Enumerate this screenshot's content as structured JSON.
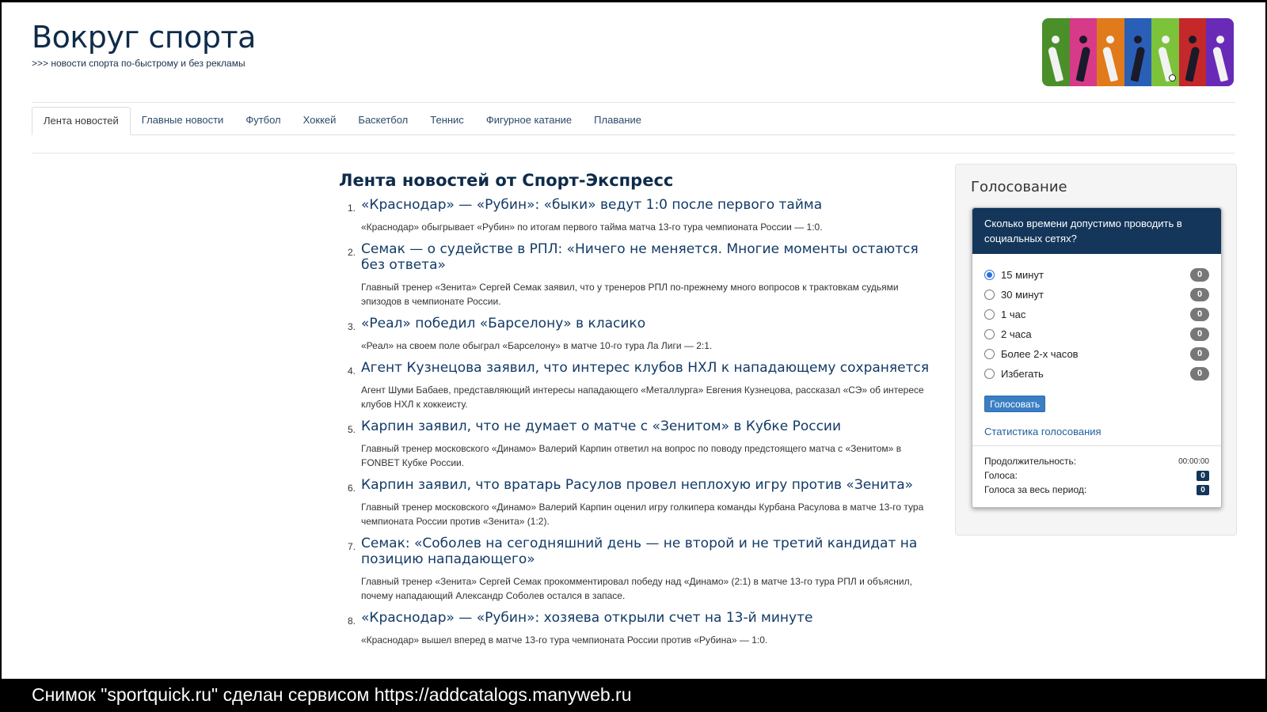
{
  "header": {
    "site_title": "Вокруг спорта",
    "tagline": ">>> новости спорта по-быстрому и без рекламы",
    "banner_colors": [
      "#4a8f2a",
      "#d83a8a",
      "#e07a1a",
      "#2a5fb8",
      "#7cc23a",
      "#c4282a",
      "#6a2ab8"
    ]
  },
  "nav": {
    "tabs": [
      {
        "label": "Лента новостей",
        "active": true
      },
      {
        "label": "Главные новости"
      },
      {
        "label": "Футбол"
      },
      {
        "label": "Хоккей"
      },
      {
        "label": "Баскетбол"
      },
      {
        "label": "Теннис"
      },
      {
        "label": "Фигурное катание"
      },
      {
        "label": "Плавание"
      }
    ]
  },
  "news": {
    "heading": "Лента новостей от Спорт-Экспресс",
    "items": [
      {
        "num": "1.",
        "title": "«Краснодар» — «Рубин»: «быки» ведут 1:0 после первого тайма",
        "summary": "«Краснодар» обыгрывает «Рубин» по итогам первого тайма матча 13-го тура чемпионата России — 1:0."
      },
      {
        "num": "2.",
        "title": "Семак — о судействе в РПЛ: «Ничего не меняется. Многие моменты остаются без ответа»",
        "summary": "Главный тренер «Зенита» Сергей Семак заявил, что у тренеров РПЛ по-прежнему много вопросов к трактовкам судьями эпизодов в чемпионате России."
      },
      {
        "num": "3.",
        "title": "«Реал» победил «Барселону» в класико",
        "summary": "«Реал» на своем поле обыграл «Барселону» в матче 10-го тура Ла Лиги — 2:1."
      },
      {
        "num": "4.",
        "title": "Агент Кузнецова заявил, что интерес клубов НХЛ к нападающему сохраняется",
        "summary": "Агент Шуми Бабаев, представляющий интересы нападающего «Металлурга» Евгения Кузнецова, рассказал «СЭ» об интересе клубов НХЛ к хоккеисту."
      },
      {
        "num": "5.",
        "title": "Карпин заявил, что не думает о матче с «Зенитом» в Кубке России",
        "summary": "Главный тренер московского «Динамо» Валерий Карпин ответил на вопрос по поводу предстоящего матча с «Зенитом» в FONBET Кубке России."
      },
      {
        "num": "6.",
        "title": "Карпин заявил, что вратарь Расулов провел неплохую игру против «Зенита»",
        "summary": "Главный тренер московского «Динамо» Валерий Карпин оценил игру голкипера команды Курбана Расулова в матче 13-го тура чемпионата России против «Зенита» (1:2)."
      },
      {
        "num": "7.",
        "title": "Семак: «Соболев на сегодняшний день — не второй и не третий кандидат на позицию нападающего»",
        "summary": "Главный тренер «Зенита» Сергей Семак прокомментировал победу над «Динамо» (2:1) в матче 13-го тура РПЛ и объяснил, почему нападающий Александр Соболев остался в запасе."
      },
      {
        "num": "8.",
        "title": "«Краснодар» — «Рубин»: хозяева открыли счет на 13-й минуте",
        "summary": "«Краснодар» вышел вперед в матче 13-го тура чемпионата России против «Рубина» — 1:0."
      }
    ]
  },
  "poll": {
    "panel_title": "Голосование",
    "question": "Сколько времени допустимо проводить в социальных сетях?",
    "options": [
      {
        "label": "15 минут",
        "count": "0",
        "checked": true
      },
      {
        "label": "30 минут",
        "count": "0"
      },
      {
        "label": "1 час",
        "count": "0"
      },
      {
        "label": "2 часа",
        "count": "0"
      },
      {
        "label": "Более 2-х часов",
        "count": "0"
      },
      {
        "label": "Избегать",
        "count": "0"
      }
    ],
    "vote_label": "Голосовать",
    "stats_link": "Статистика голосования",
    "duration_label": "Продолжительность:",
    "duration_value": "00:00:00",
    "votes_label": "Голоса:",
    "votes_value": "0",
    "total_votes_label": "Голоса за весь период:",
    "total_votes_value": "0"
  },
  "caption": {
    "text": "Снимок \"sportquick.ru\" сделан сервисом https://addcatalogs.manyweb.ru"
  }
}
